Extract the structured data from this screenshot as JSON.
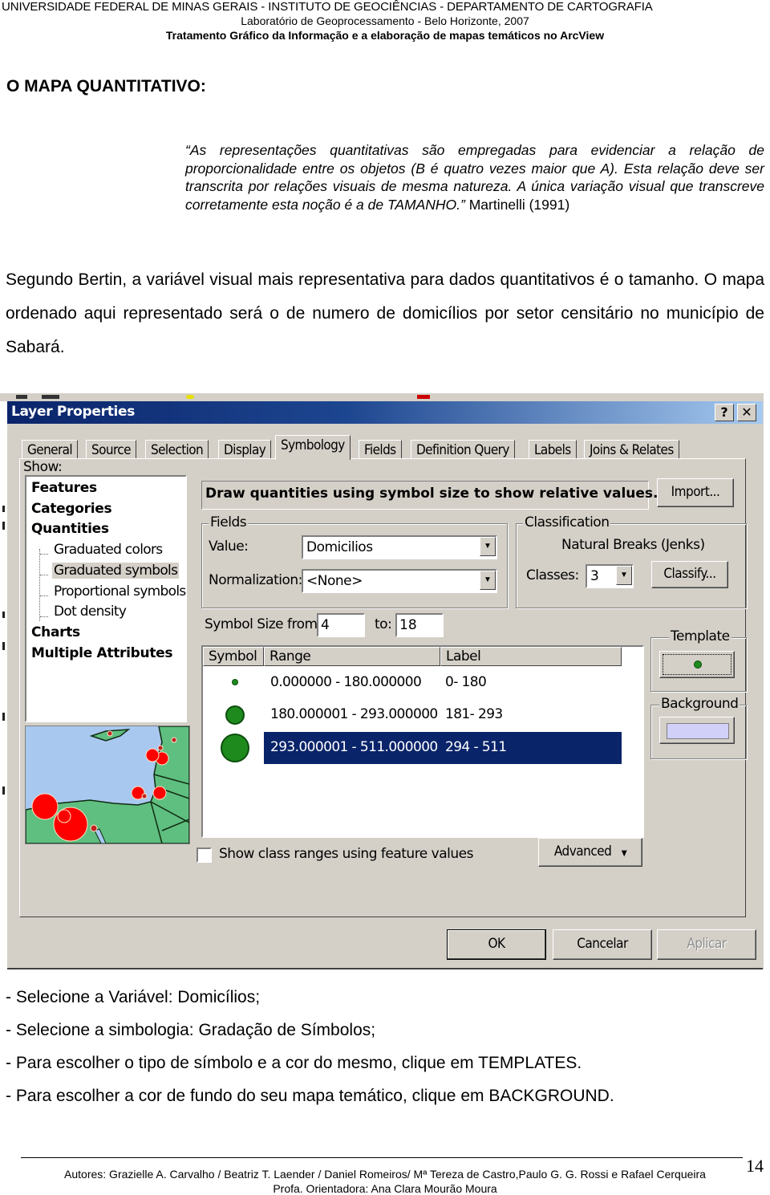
{
  "header": {
    "line1": "UNIVERSIDADE FEDERAL DE MINAS GERAIS - INSTITUTO DE GEOCIÊNCIAS - DEPARTAMENTO DE CARTOGRAFIA",
    "line2": "Laboratório de Geoprocessamento - Belo Horizonte, 2007",
    "line3": "Tratamento Gráfico da Informação e a  elaboração de mapas temáticos no ArcView"
  },
  "section_title": "O MAPA QUANTITATIVO:",
  "quote": {
    "text": "“As representações quantitativas são empregadas para evidenciar a relação de proporcionalidade entre os objetos (B é quatro vezes maior que A). Esta relação deve ser transcrita por relações visuais de mesma natureza. A única variação visual que transcreve corretamente esta noção é a de TAMANHO.”",
    "author": " Martinelli (1991)"
  },
  "paragraph": "Segundo Bertin, a variável visual mais representativa para dados quantitativos é o tamanho. O mapa ordenado aqui representado será o de numero de domicílios por setor censitário no município de Sabará.",
  "dialog": {
    "title": "Layer Properties",
    "help_label": "?",
    "close_label": "✕",
    "tabs": [
      {
        "label": "General"
      },
      {
        "label": "Source"
      },
      {
        "label": "Selection"
      },
      {
        "label": "Display"
      },
      {
        "label": "Symbology",
        "active": true
      },
      {
        "label": "Fields"
      },
      {
        "label": "Definition Query"
      },
      {
        "label": "Labels"
      },
      {
        "label": "Joins & Relates"
      }
    ],
    "show_label": "Show:",
    "show_list": {
      "features": "Features",
      "categories": "Categories",
      "quantities": "Quantities",
      "graduated_colors": "Graduated colors",
      "graduated_symbols": "Graduated symbols",
      "proportional_symbols": "Proportional symbols",
      "dot_density": "Dot density",
      "charts": "Charts",
      "multiple_attributes": "Multiple Attributes",
      "selected": "Graduated symbols"
    },
    "description": "Draw quantities using symbol size to show relative values.",
    "import_label": "Import...",
    "fields": {
      "caption": "Fields",
      "value_label": "Value:",
      "value": "Domicilios",
      "normalization_label": "Normalization:",
      "normalization": "<None>"
    },
    "classification": {
      "caption": "Classification",
      "method": "Natural Breaks (Jenks)",
      "classes_label": "Classes:",
      "classes": "3",
      "classify_label": "Classify..."
    },
    "symbol_size": {
      "from_label": "Symbol Size from:",
      "from": "4",
      "to_label": "to:",
      "to": "18"
    },
    "grid": {
      "headers": [
        "Symbol",
        "Range",
        "Label"
      ],
      "rows": [
        {
          "range": "0.000000 - 180.000000",
          "label": "0- 180",
          "selected": false
        },
        {
          "range": "180.000001 - 293.000000",
          "label": "181- 293",
          "selected": false
        },
        {
          "range": "293.000001 - 511.000000",
          "label": "294 - 511",
          "selected": true
        }
      ]
    },
    "template_caption": "Template",
    "background_caption": "Background",
    "show_class_ranges_label": "Show class ranges using feature values",
    "show_class_ranges_checked": false,
    "advanced_label": "Advanced",
    "ok_label": "OK",
    "cancel_label": "Cancelar",
    "apply_label": "Aplicar",
    "colors": {
      "symbol_fill": "#1e8a1e",
      "background_swatch": "#d0d0f8",
      "selection": "#0a246a"
    }
  },
  "steps": [
    "- Selecione a Variável: Domicílios;",
    "- Selecione a simbologia: Gradação de Símbolos;",
    "- Para escolher o tipo de símbolo e a cor do mesmo, clique em TEMPLATES.",
    "- Para escolher a cor de fundo do seu mapa temático, clique em BACKGROUND."
  ],
  "footer": {
    "authors": "Autores: Grazielle A. Carvalho / Beatriz T. Laender / Daniel Romeiros/ Mª Tereza de Castro,Paulo G. G. Rossi  e Rafael Cerqueira",
    "advisor": "Profa. Orientadora: Ana Clara Mourão Moura",
    "page_number": "14"
  }
}
